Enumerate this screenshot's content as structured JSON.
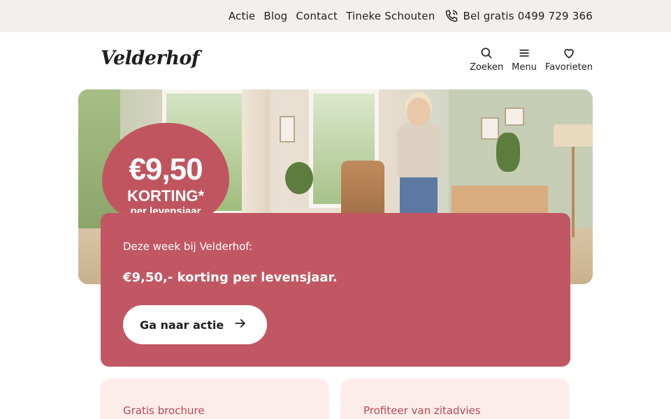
{
  "topbar": {
    "links": [
      "Actie",
      "Blog",
      "Contact",
      "Tineke Schouten"
    ],
    "phone_label": "Bel gratis 0499 729 366",
    "phone_icon": "phone-icon"
  },
  "header": {
    "logo": "Velderhof",
    "actions": [
      {
        "label": "Zoeken",
        "icon": "search-icon"
      },
      {
        "label": "Menu",
        "icon": "menu-icon"
      },
      {
        "label": "Favorieten",
        "icon": "heart-icon"
      }
    ]
  },
  "hero": {
    "badge": {
      "amount": "€9,50",
      "label": "KORTING*",
      "sub": "per levensjaar"
    }
  },
  "promo": {
    "kicker": "Deze week bij Velderhof:",
    "title": "€9,50,- korting per levensjaar.",
    "button_label": "Ga naar actie",
    "button_icon": "arrow-right-icon"
  },
  "cards": [
    {
      "title": "Gratis brochure"
    },
    {
      "title": "Profiteer van zitadvies"
    }
  ],
  "colors": {
    "accent": "#c15763",
    "topbar_bg": "#f3efed",
    "card_bg": "#fcecea"
  }
}
